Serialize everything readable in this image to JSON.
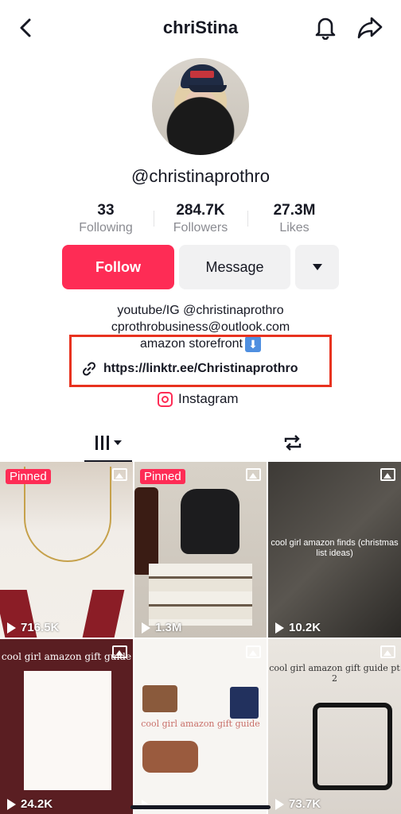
{
  "header": {
    "title": "chriStina",
    "back_icon": "chevron-left-icon",
    "bell_icon": "bell-icon",
    "share_icon": "share-arrow-icon"
  },
  "profile": {
    "username": "@christinaprothro"
  },
  "stats": [
    {
      "value": "33",
      "label": "Following"
    },
    {
      "value": "284.7K",
      "label": "Followers"
    },
    {
      "value": "27.3M",
      "label": "Likes"
    }
  ],
  "actions": {
    "follow": "Follow",
    "message": "Message"
  },
  "bio": {
    "line1": "youtube/IG @christinaprothro",
    "line2": "cprothrobusiness@outlook.com",
    "line3": "amazon storefront",
    "down_emoji": "⬇"
  },
  "link": {
    "url": "https://linktr.ee/Christinaprothro"
  },
  "instagram": {
    "label": "Instagram"
  },
  "tabs": {
    "videos_icon": "grid-icon",
    "reposts_icon": "repost-icon"
  },
  "colors": {
    "accent": "#fe2c55",
    "highlight_box": "#e8321f"
  },
  "videos": [
    {
      "pinned": "Pinned",
      "views": "716.5K",
      "caption": ""
    },
    {
      "pinned": "Pinned",
      "views": "1.3M",
      "caption": ""
    },
    {
      "pinned": "",
      "views": "10.2K",
      "caption": "cool girl amazon finds (christmas list ideas)"
    },
    {
      "pinned": "",
      "views": "24.2K",
      "caption": "cool girl amazon gift guide"
    },
    {
      "pinned": "",
      "views": "",
      "caption": "cool girl amazon gift guide"
    },
    {
      "pinned": "",
      "views": "73.7K",
      "caption": "cool girl amazon gift guide pt 2"
    }
  ]
}
